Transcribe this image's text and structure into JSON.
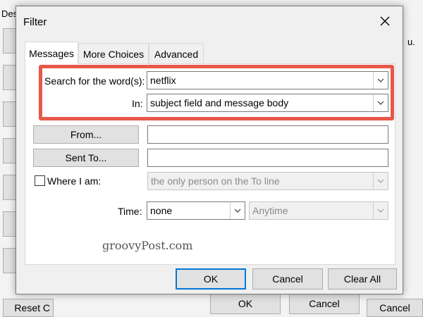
{
  "background_window": {
    "left_label": "Des",
    "right_fragment": "u.",
    "bottom_left_button": "Reset C",
    "ok_label": "OK",
    "cancel_label": "Cancel",
    "right_cancel_label": "Cancel"
  },
  "dialog": {
    "title": "Filter",
    "tabs": [
      {
        "label": "Messages",
        "active": true
      },
      {
        "label": "More Choices",
        "active": false
      },
      {
        "label": "Advanced",
        "active": false
      }
    ],
    "search": {
      "label": "Search for the word(s):",
      "value": "netflix"
    },
    "in_field": {
      "label": "In:",
      "value": "subject field and message body"
    },
    "from_button": "From...",
    "from_value": "",
    "sent_to_button": "Sent To...",
    "sent_to_value": "",
    "where_i_am": {
      "label": "Where I am:",
      "checked": false,
      "value": "the only person on the To line"
    },
    "time": {
      "label": "Time:",
      "value": "none",
      "range_value": "Anytime"
    },
    "watermark": "groovyPost.com",
    "buttons": {
      "ok": "OK",
      "cancel": "Cancel",
      "clear_all": "Clear All"
    }
  },
  "colors": {
    "highlight": "#e8574a",
    "default_button_border": "#0078d7"
  }
}
